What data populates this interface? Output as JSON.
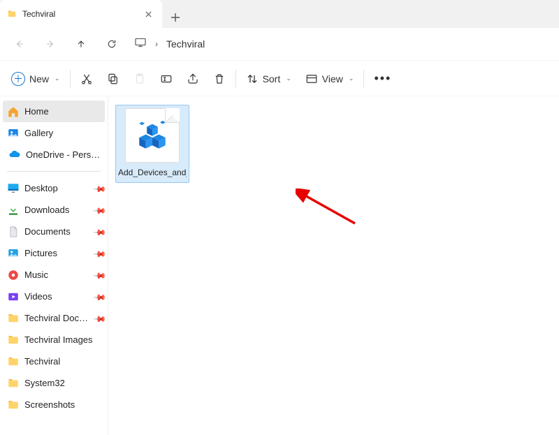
{
  "tab": {
    "title": "Techviral"
  },
  "breadcrumb": {
    "location": "Techviral"
  },
  "toolbar": {
    "new_label": "New",
    "sort_label": "Sort",
    "view_label": "View"
  },
  "sidebar": {
    "top": [
      {
        "label": "Home",
        "icon": "home-icon",
        "selected": true
      },
      {
        "label": "Gallery",
        "icon": "gallery-icon",
        "selected": false
      },
      {
        "label": "OneDrive - Persona",
        "icon": "onedrive-icon",
        "selected": false,
        "expander": true
      }
    ],
    "quick": [
      {
        "label": "Desktop",
        "icon": "desktop-icon",
        "pinned": true
      },
      {
        "label": "Downloads",
        "icon": "downloads-icon",
        "pinned": true
      },
      {
        "label": "Documents",
        "icon": "documents-icon",
        "pinned": true
      },
      {
        "label": "Pictures",
        "icon": "pictures-icon",
        "pinned": true
      },
      {
        "label": "Music",
        "icon": "music-icon",
        "pinned": true
      },
      {
        "label": "Videos",
        "icon": "videos-icon",
        "pinned": true
      },
      {
        "label": "Techviral Docum",
        "icon": "folder-icon",
        "pinned": true
      },
      {
        "label": "Techviral Images",
        "icon": "folder-icon",
        "pinned": false
      },
      {
        "label": "Techviral",
        "icon": "folder-icon",
        "pinned": false
      },
      {
        "label": "System32",
        "icon": "folder-icon",
        "pinned": false
      },
      {
        "label": "Screenshots",
        "icon": "folder-icon",
        "pinned": false
      }
    ]
  },
  "files": [
    {
      "name": "Add_Devices_and_Printers_to_top_of_navigation_pane_of_File_Explo...",
      "type": "registry",
      "selected": true
    }
  ]
}
